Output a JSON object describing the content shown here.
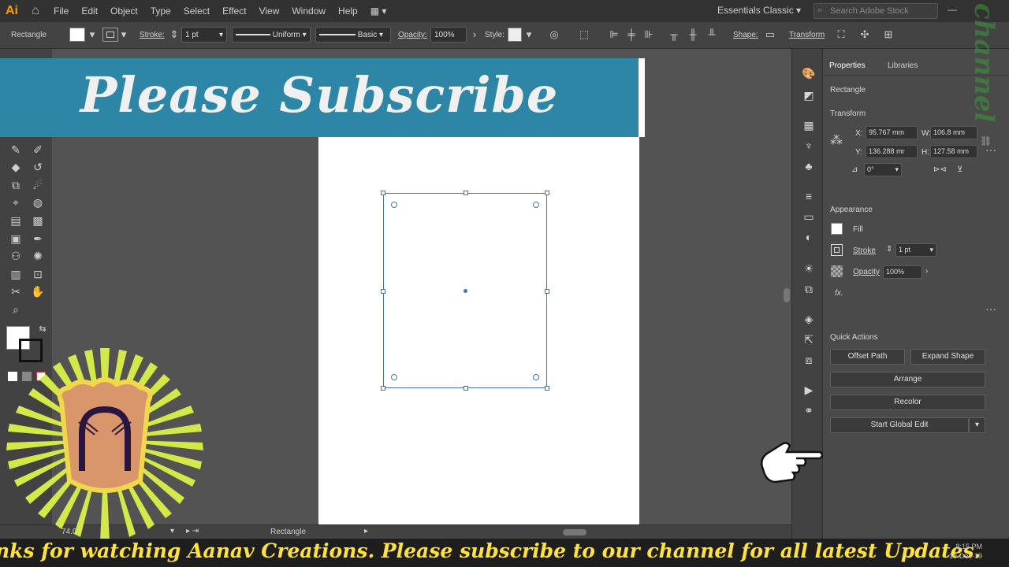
{
  "app": {
    "logo_text": "Ai"
  },
  "menubar": {
    "items": [
      "File",
      "Edit",
      "Object",
      "Type",
      "Select",
      "Effect",
      "View",
      "Window",
      "Help"
    ],
    "workspace": "Essentials Classic",
    "search_placeholder": "Search Adobe Stock"
  },
  "control_bar": {
    "object_type": "Rectangle",
    "stroke_label": "Stroke:",
    "stroke_value": "1 pt",
    "stroke_profile": "Uniform",
    "brush": "Basic",
    "opacity_label": "Opacity:",
    "opacity_value": "100%",
    "style_label": "Style:",
    "shape_label": "Shape:",
    "transform_label": "Transform"
  },
  "status_bar": {
    "tool": "Rectangle",
    "zoom": "74.03"
  },
  "properties": {
    "tabs": [
      "Properties",
      "Libraries"
    ],
    "selection": "Rectangle",
    "transform": {
      "title": "Transform",
      "x": "95.767 mm",
      "y": "136.288 mr",
      "w": "106.8 mm",
      "h": "127.58 mm",
      "angle": "0°"
    },
    "appearance": {
      "title": "Appearance",
      "fill_label": "Fill",
      "stroke_label": "Stroke",
      "stroke_value": "1 pt",
      "opacity_label": "Opacity",
      "opacity_value": "100%",
      "fx_label": "fx."
    },
    "quick_actions": {
      "title": "Quick Actions",
      "offset_path": "Offset Path",
      "expand_shape": "Expand Shape",
      "arrange": "Arrange",
      "recolor": "Recolor",
      "start_global_edit": "Start Global Edit"
    }
  },
  "overlay": {
    "banner": "Please Subscribe",
    "ticker": "nks for watching Aanav Creations. Please subscribe to our channel for all latest Updates.",
    "watermark": "channel"
  },
  "clock": {
    "time": "8:15 PM",
    "date": "19-Dec-19"
  },
  "colors": {
    "banner_bg": "#2d86a5",
    "ticker_text": "#ffe23b",
    "selection": "#4a6fb3"
  }
}
